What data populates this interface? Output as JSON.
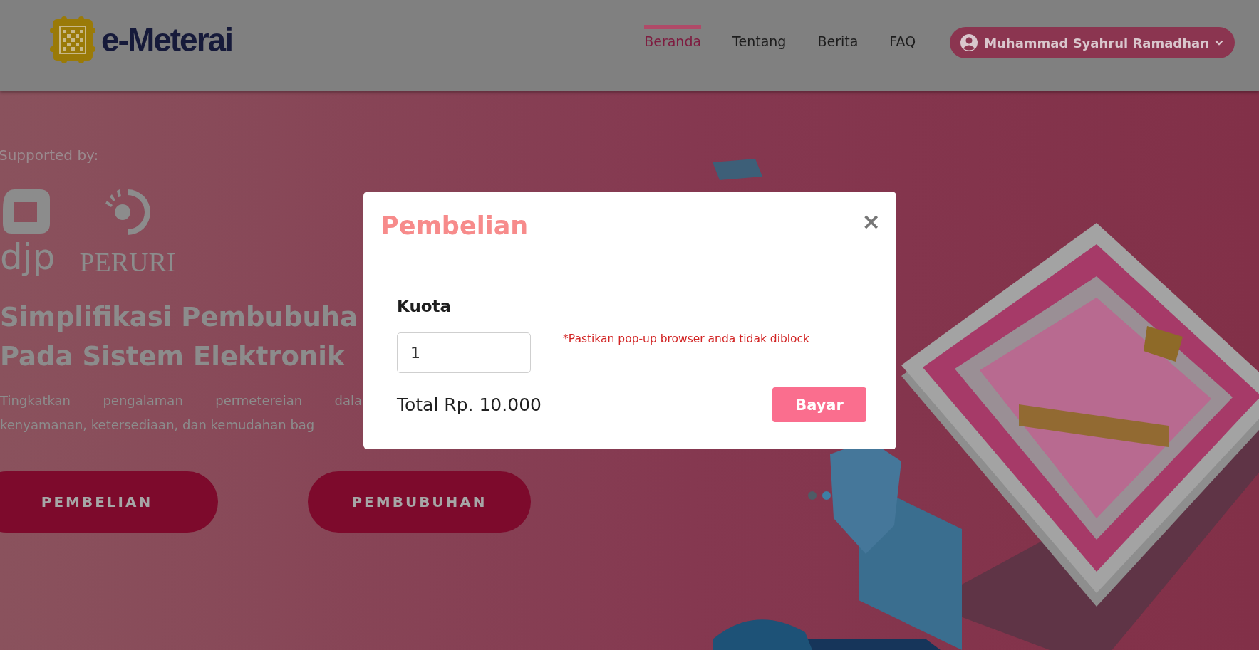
{
  "header": {
    "logo": {
      "text": "e-Meterai"
    },
    "nav": [
      {
        "label": "Beranda",
        "selected": true
      },
      {
        "label": "Tentang",
        "selected": false
      },
      {
        "label": "Berita",
        "selected": false
      },
      {
        "label": "FAQ",
        "selected": false
      }
    ],
    "user_menu": {
      "name": "Muhammad Syahrul Ramadhan"
    }
  },
  "hero": {
    "supported_by": "Supported by:",
    "partners": [
      {
        "kind": "djp",
        "text": "djp"
      },
      {
        "kind": "peruri",
        "text": "PERURI"
      }
    ],
    "heading_lines": [
      "Simplifikasi Pembubuha",
      "Pada Sistem Elektronik"
    ],
    "description_lines": [
      "Tingkatkan pengalaman permetereian dala",
      "kenyamanan, ketersediaan, dan kemudahan bag"
    ],
    "buttons": [
      "PEMBELIAN",
      "PEMBUBUHAN"
    ]
  },
  "modal": {
    "title": "Pembelian",
    "close": "×",
    "field": {
      "label": "Kuota",
      "value": "1"
    },
    "note": "*Pastikan pop-up browser anda tidak diblock",
    "total": "Total Rp. 10.000",
    "submit": "Bayar"
  }
}
